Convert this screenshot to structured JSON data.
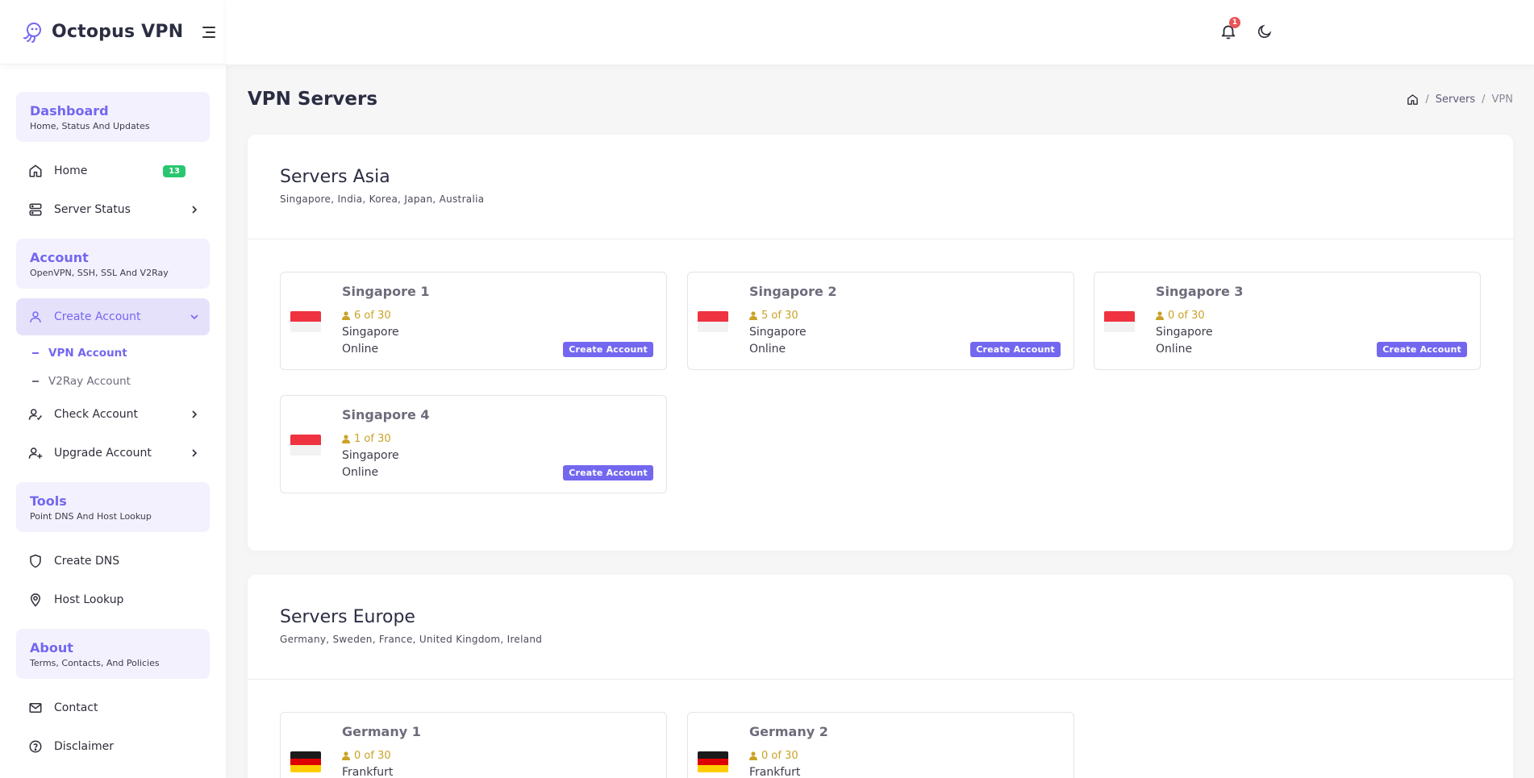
{
  "brand": {
    "name": "Octopus VPN"
  },
  "sidebar": {
    "sections": [
      {
        "title": "Dashboard",
        "subtitle": "Home, Status And Updates"
      },
      {
        "title": "Account",
        "subtitle": "OpenVPN, SSH, SSL And V2Ray"
      },
      {
        "title": "Tools",
        "subtitle": "Point DNS And Host Lookup"
      },
      {
        "title": "About",
        "subtitle": "Terms, Contacts, And Policies"
      }
    ],
    "items": {
      "home": {
        "label": "Home",
        "badge": "13"
      },
      "server_status": {
        "label": "Server Status"
      },
      "create_account": {
        "label": "Create Account"
      },
      "vpn_account": {
        "label": "VPN Account"
      },
      "v2ray_account": {
        "label": "V2Ray Account"
      },
      "check_account": {
        "label": "Check Account"
      },
      "upgrade_account": {
        "label": "Upgrade Account"
      },
      "create_dns": {
        "label": "Create DNS"
      },
      "host_lookup": {
        "label": "Host Lookup"
      },
      "contact": {
        "label": "Contact"
      },
      "disclaimer": {
        "label": "Disclaimer"
      }
    }
  },
  "header": {
    "notification_count": "1"
  },
  "page": {
    "title": "VPN Servers",
    "breadcrumb": [
      "Servers",
      "VPN"
    ]
  },
  "regions": {
    "asia": {
      "title": "Servers Asia",
      "subtitle": "Singapore, India, Korea, Japan, Australia",
      "servers": [
        {
          "name": "Singapore 1",
          "users": "6 of 30",
          "location": "Singapore",
          "status": "Online",
          "button": "Create Account",
          "flag": "sg"
        },
        {
          "name": "Singapore 2",
          "users": "5 of 30",
          "location": "Singapore",
          "status": "Online",
          "button": "Create Account",
          "flag": "sg"
        },
        {
          "name": "Singapore 3",
          "users": "0 of 30",
          "location": "Singapore",
          "status": "Online",
          "button": "Create Account",
          "flag": "sg"
        },
        {
          "name": "Singapore 4",
          "users": "1 of 30",
          "location": "Singapore",
          "status": "Online",
          "button": "Create Account",
          "flag": "sg"
        }
      ]
    },
    "europe": {
      "title": "Servers Europe",
      "subtitle": "Germany, Sweden, France, United Kingdom, Ireland",
      "servers": [
        {
          "name": "Germany 1",
          "users": "0 of 30",
          "location": "Frankfurt",
          "flag": "de"
        },
        {
          "name": "Germany 2",
          "users": "0 of 30",
          "location": "Frankfurt",
          "flag": "de"
        }
      ]
    }
  },
  "colors": {
    "accent": "#7367f0",
    "badge_green": "#28c76f",
    "notification_red": "#ea5455",
    "users_gold": "#c9a227"
  },
  "icons": {
    "brand": "octopus-icon",
    "menu": "menu-icon",
    "home": "home-icon",
    "server": "server-icon",
    "user": "user-icon",
    "user_check": "user-check-icon",
    "user_plus": "user-plus-icon",
    "shield": "shield-icon",
    "pin": "map-pin-icon",
    "mail": "mail-icon",
    "help": "help-circle-icon",
    "bell": "bell-icon",
    "moon": "moon-icon",
    "chevron_right": "chevron-right-icon",
    "chevron_down": "chevron-down-icon"
  }
}
